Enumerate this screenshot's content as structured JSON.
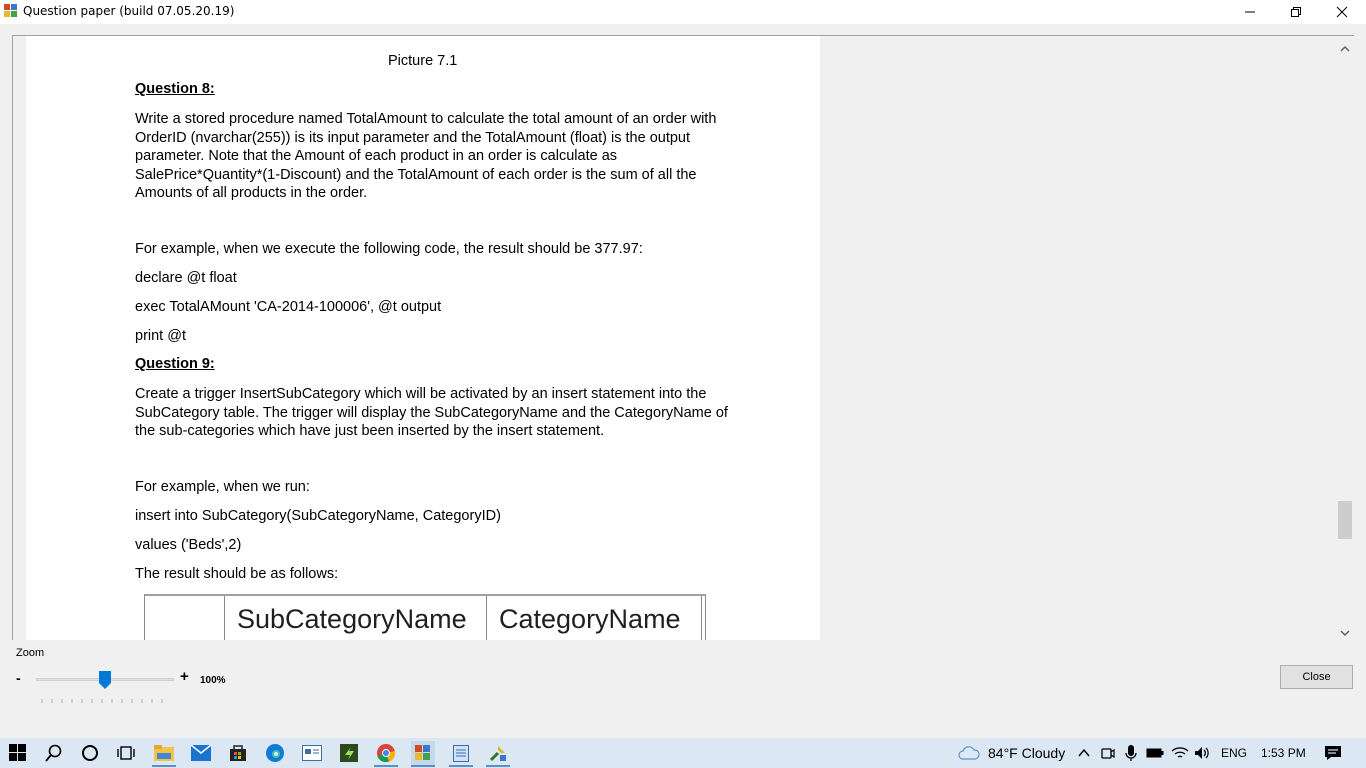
{
  "window": {
    "title": "Question paper (build 07.05.20.19)"
  },
  "document": {
    "picture_caption": "Picture 7.1",
    "q8": {
      "heading": "Question 8:",
      "lines": [
        "Write a stored procedure named TotalAmount to calculate the total amount of an order with",
        "OrderID (nvarchar(255)) is its input parameter and the TotalAmount (float) is the output",
        "parameter. Note that the Amount of each product in an order is calculate as",
        "SalePrice*Quantity*(1-Discount) and the TotalAmount of each order is the sum of all the",
        "Amounts of all products in the order."
      ],
      "example_intro": "For example, when we execute the following code, the result should be 377.97:",
      "code1": "declare @t float",
      "code2": "exec TotalAMount 'CA-2014-100006', @t output",
      "code3": "print @t"
    },
    "q9": {
      "heading": "Question 9:",
      "lines": [
        "Create a trigger InsertSubCategory which will be activated by an insert statement into the",
        "SubCategory table. The trigger will display the SubCategoryName and the CategoryName of",
        "the sub-categories which have just been inserted by the insert statement."
      ],
      "example_intro": "For example, when we run:",
      "code1": "insert into SubCategory(SubCategoryName, CategoryID)",
      "code2": "values ('Beds',2)",
      "result_intro": "The result should be as follows:",
      "table_headers": [
        "",
        "SubCategoryName",
        "CategoryName"
      ]
    }
  },
  "zoom": {
    "label": "Zoom",
    "minus": "-",
    "plus": "+",
    "value": "100%",
    "level_fraction": 0.5
  },
  "buttons": {
    "close": "Close"
  },
  "taskbar": {
    "weather": "84°F  Cloudy",
    "language": "ENG",
    "time": "1:53 PM",
    "pinned_icons": [
      "windows-start-icon",
      "search-icon",
      "cortana-icon",
      "task-view-icon",
      "file-explorer-icon",
      "mail-icon",
      "store-icon",
      "edge-icon",
      "app-window-icon",
      "green-app-icon",
      "chrome-icon",
      "question-paper-app-icon",
      "notepad-icon",
      "tool-app-icon"
    ]
  },
  "colors": {
    "accent": "#0078d7",
    "taskbar_bg": "#dbe7f3"
  }
}
